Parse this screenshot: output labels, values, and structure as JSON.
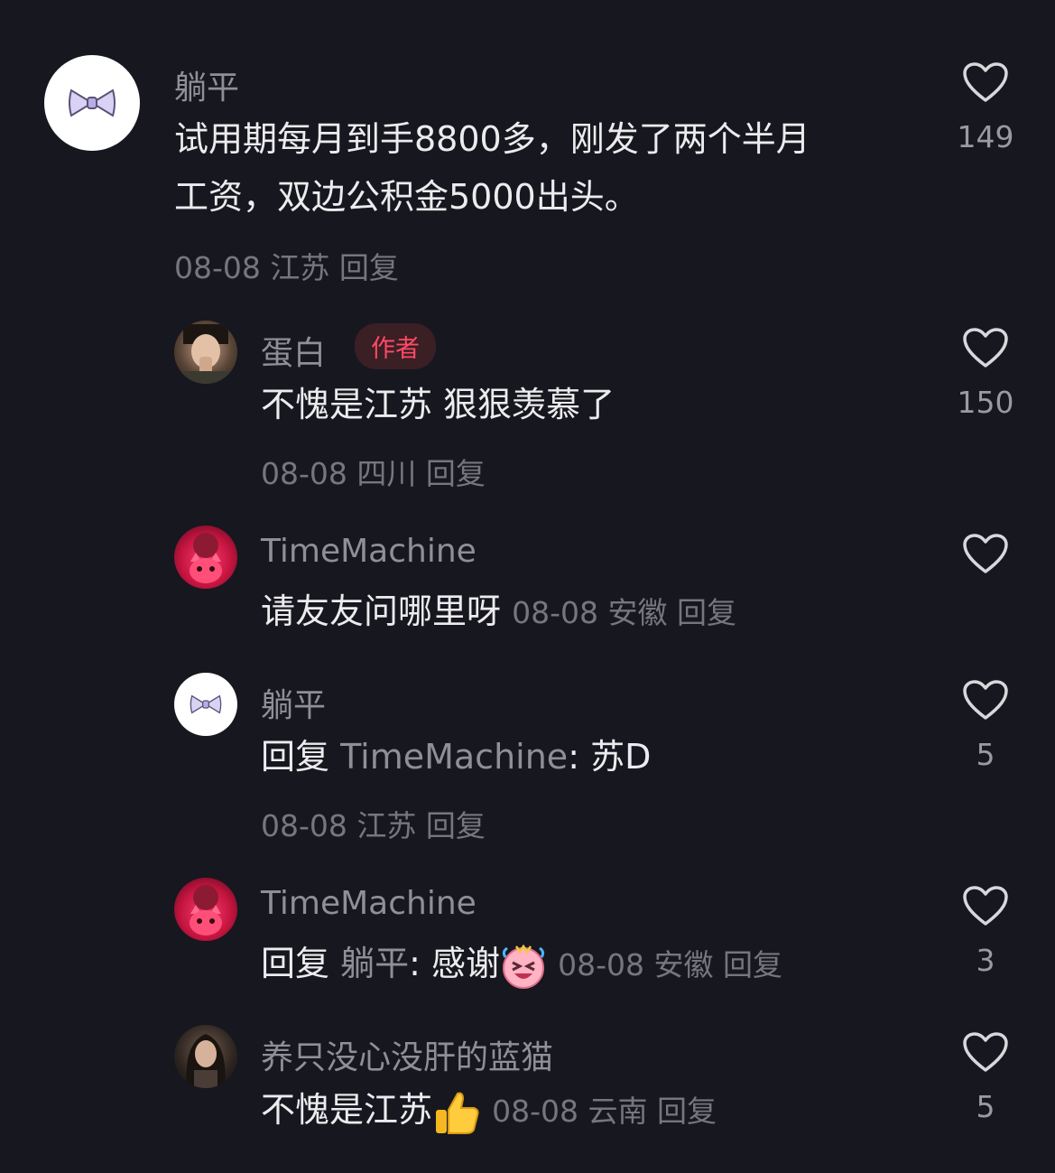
{
  "comments": [
    {
      "author": "躺平",
      "text_lines": [
        "试用期每月到手8800多，刚发了两个半月",
        "工资，双边公积金5000出头。"
      ],
      "date": "08-08",
      "location": "江苏",
      "reply_label": "回复",
      "likes": "149",
      "avatar_icon": "bow-avatar-icon"
    },
    {
      "author": "蛋白",
      "badge": "作者",
      "text": "不愧是江苏  狠狠羡慕了",
      "date": "08-08",
      "location": "四川",
      "reply_label": "回复",
      "likes": "150",
      "avatar_icon": "portrait-avatar-icon"
    },
    {
      "author": "TimeMachine",
      "text": "请友友问哪里呀",
      "date": "08-08",
      "location": "安徽",
      "reply_label": "回复",
      "likes": "",
      "avatar_icon": "red-cat-avatar-icon"
    },
    {
      "author": "躺平",
      "reply_prefix": "回复",
      "reply_to": "TimeMachine",
      "text": ": 苏D",
      "date": "08-08",
      "location": "江苏",
      "reply_label": "回复",
      "likes": "5",
      "avatar_icon": "bow-avatar-icon"
    },
    {
      "author": "TimeMachine",
      "reply_prefix": "回复",
      "reply_to": "躺平",
      "text": ": 感谢",
      "emoji": "laughing-cry-emoji",
      "date": "08-08",
      "location": "安徽",
      "reply_label": "回复",
      "likes": "3",
      "avatar_icon": "red-cat-avatar-icon"
    },
    {
      "author": "养只没心没肝的蓝猫",
      "text": "不愧是江苏",
      "emoji": "thumbs-up-emoji",
      "date": "08-08",
      "location": "云南",
      "reply_label": "回复",
      "likes": "5",
      "avatar_icon": "woman-portrait-avatar-icon"
    }
  ],
  "colors": {
    "background": "#17171f",
    "author_badge_text": "#ff4a63",
    "author_badge_bg": "#3a1f25"
  }
}
